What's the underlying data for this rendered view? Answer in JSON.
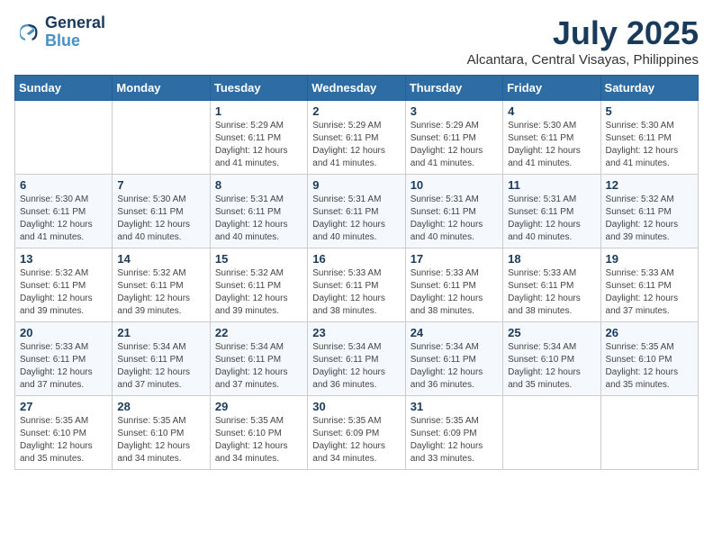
{
  "logo": {
    "line1": "General",
    "line2": "Blue"
  },
  "title": "July 2025",
  "location": "Alcantara, Central Visayas, Philippines",
  "days_of_week": [
    "Sunday",
    "Monday",
    "Tuesday",
    "Wednesday",
    "Thursday",
    "Friday",
    "Saturday"
  ],
  "weeks": [
    [
      {
        "num": "",
        "info": ""
      },
      {
        "num": "",
        "info": ""
      },
      {
        "num": "1",
        "info": "Sunrise: 5:29 AM\nSunset: 6:11 PM\nDaylight: 12 hours and 41 minutes."
      },
      {
        "num": "2",
        "info": "Sunrise: 5:29 AM\nSunset: 6:11 PM\nDaylight: 12 hours and 41 minutes."
      },
      {
        "num": "3",
        "info": "Sunrise: 5:29 AM\nSunset: 6:11 PM\nDaylight: 12 hours and 41 minutes."
      },
      {
        "num": "4",
        "info": "Sunrise: 5:30 AM\nSunset: 6:11 PM\nDaylight: 12 hours and 41 minutes."
      },
      {
        "num": "5",
        "info": "Sunrise: 5:30 AM\nSunset: 6:11 PM\nDaylight: 12 hours and 41 minutes."
      }
    ],
    [
      {
        "num": "6",
        "info": "Sunrise: 5:30 AM\nSunset: 6:11 PM\nDaylight: 12 hours and 41 minutes."
      },
      {
        "num": "7",
        "info": "Sunrise: 5:30 AM\nSunset: 6:11 PM\nDaylight: 12 hours and 40 minutes."
      },
      {
        "num": "8",
        "info": "Sunrise: 5:31 AM\nSunset: 6:11 PM\nDaylight: 12 hours and 40 minutes."
      },
      {
        "num": "9",
        "info": "Sunrise: 5:31 AM\nSunset: 6:11 PM\nDaylight: 12 hours and 40 minutes."
      },
      {
        "num": "10",
        "info": "Sunrise: 5:31 AM\nSunset: 6:11 PM\nDaylight: 12 hours and 40 minutes."
      },
      {
        "num": "11",
        "info": "Sunrise: 5:31 AM\nSunset: 6:11 PM\nDaylight: 12 hours and 40 minutes."
      },
      {
        "num": "12",
        "info": "Sunrise: 5:32 AM\nSunset: 6:11 PM\nDaylight: 12 hours and 39 minutes."
      }
    ],
    [
      {
        "num": "13",
        "info": "Sunrise: 5:32 AM\nSunset: 6:11 PM\nDaylight: 12 hours and 39 minutes."
      },
      {
        "num": "14",
        "info": "Sunrise: 5:32 AM\nSunset: 6:11 PM\nDaylight: 12 hours and 39 minutes."
      },
      {
        "num": "15",
        "info": "Sunrise: 5:32 AM\nSunset: 6:11 PM\nDaylight: 12 hours and 39 minutes."
      },
      {
        "num": "16",
        "info": "Sunrise: 5:33 AM\nSunset: 6:11 PM\nDaylight: 12 hours and 38 minutes."
      },
      {
        "num": "17",
        "info": "Sunrise: 5:33 AM\nSunset: 6:11 PM\nDaylight: 12 hours and 38 minutes."
      },
      {
        "num": "18",
        "info": "Sunrise: 5:33 AM\nSunset: 6:11 PM\nDaylight: 12 hours and 38 minutes."
      },
      {
        "num": "19",
        "info": "Sunrise: 5:33 AM\nSunset: 6:11 PM\nDaylight: 12 hours and 37 minutes."
      }
    ],
    [
      {
        "num": "20",
        "info": "Sunrise: 5:33 AM\nSunset: 6:11 PM\nDaylight: 12 hours and 37 minutes."
      },
      {
        "num": "21",
        "info": "Sunrise: 5:34 AM\nSunset: 6:11 PM\nDaylight: 12 hours and 37 minutes."
      },
      {
        "num": "22",
        "info": "Sunrise: 5:34 AM\nSunset: 6:11 PM\nDaylight: 12 hours and 37 minutes."
      },
      {
        "num": "23",
        "info": "Sunrise: 5:34 AM\nSunset: 6:11 PM\nDaylight: 12 hours and 36 minutes."
      },
      {
        "num": "24",
        "info": "Sunrise: 5:34 AM\nSunset: 6:11 PM\nDaylight: 12 hours and 36 minutes."
      },
      {
        "num": "25",
        "info": "Sunrise: 5:34 AM\nSunset: 6:10 PM\nDaylight: 12 hours and 35 minutes."
      },
      {
        "num": "26",
        "info": "Sunrise: 5:35 AM\nSunset: 6:10 PM\nDaylight: 12 hours and 35 minutes."
      }
    ],
    [
      {
        "num": "27",
        "info": "Sunrise: 5:35 AM\nSunset: 6:10 PM\nDaylight: 12 hours and 35 minutes."
      },
      {
        "num": "28",
        "info": "Sunrise: 5:35 AM\nSunset: 6:10 PM\nDaylight: 12 hours and 34 minutes."
      },
      {
        "num": "29",
        "info": "Sunrise: 5:35 AM\nSunset: 6:10 PM\nDaylight: 12 hours and 34 minutes."
      },
      {
        "num": "30",
        "info": "Sunrise: 5:35 AM\nSunset: 6:09 PM\nDaylight: 12 hours and 34 minutes."
      },
      {
        "num": "31",
        "info": "Sunrise: 5:35 AM\nSunset: 6:09 PM\nDaylight: 12 hours and 33 minutes."
      },
      {
        "num": "",
        "info": ""
      },
      {
        "num": "",
        "info": ""
      }
    ]
  ]
}
